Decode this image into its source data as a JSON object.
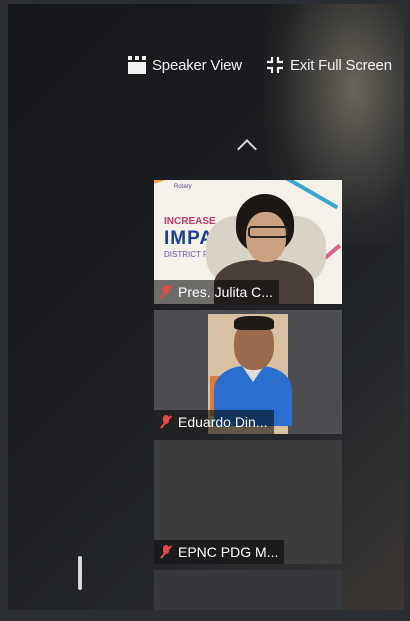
{
  "toolbar": {
    "speaker_view_label": "Speaker View",
    "exit_fullscreen_label": "Exit Full Screen",
    "speaker_view_icon": "grid-icon",
    "exit_fullscreen_icon": "exit-fullscreen-icon"
  },
  "scroll_up_icon": "chevron-up-icon",
  "participants": [
    {
      "name": "Pres. Julita C...",
      "muted": true,
      "background": {
        "line1": "INCREASE",
        "line2": "IMPACT",
        "line3": "DISTRICT PUBLIC IMAGE",
        "logo_text": "Rotary"
      }
    },
    {
      "name": "Eduardo Din...",
      "muted": true
    },
    {
      "name": "EPNC PDG M...",
      "muted": true
    }
  ],
  "colors": {
    "muted_icon": "#e34b4b",
    "name_text": "#ffffff",
    "toolbar_text": "#f2f2f2"
  }
}
